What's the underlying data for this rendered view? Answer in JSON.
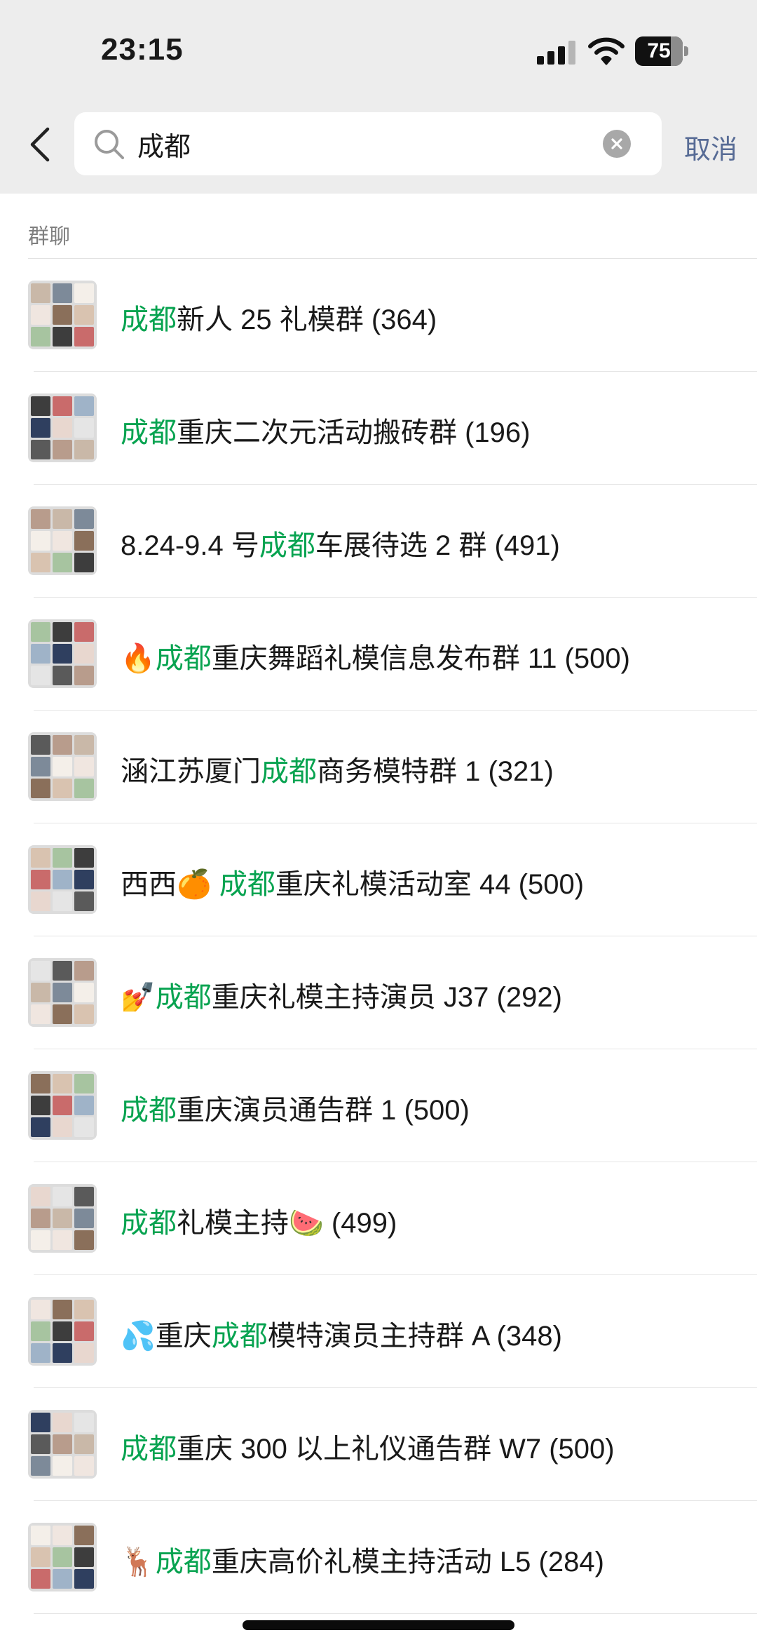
{
  "status_bar": {
    "time": "23:15",
    "battery": "75",
    "battery_level": 0.75
  },
  "search": {
    "query": "成都",
    "cancel_label": "取消"
  },
  "section_title": "群聊",
  "groups": [
    {
      "prefix": "",
      "highlight": "成都",
      "suffix": "新人 25 礼模群 (364)"
    },
    {
      "prefix": "",
      "highlight": "成都",
      "suffix": "重庆二次元活动搬砖群 (196)"
    },
    {
      "prefix": "8.24-9.4 号",
      "highlight": "成都",
      "suffix": "车展待选 2 群 (491)"
    },
    {
      "prefix": "🔥",
      "highlight": "成都",
      "suffix": "重庆舞蹈礼模信息发布群 11 (500)"
    },
    {
      "prefix": "涵江苏厦门",
      "highlight": "成都",
      "suffix": "商务模特群 1 (321)"
    },
    {
      "prefix": "西西🍊 ",
      "highlight": "成都",
      "suffix": "重庆礼模活动室 44 (500)"
    },
    {
      "prefix": "💅",
      "highlight": "成都",
      "suffix": "重庆礼模主持演员 J37 (292)"
    },
    {
      "prefix": "",
      "highlight": "成都",
      "suffix": "重庆演员通告群 1 (500)"
    },
    {
      "prefix": "",
      "highlight": "成都",
      "suffix": "礼模主持🍉 (499)"
    },
    {
      "prefix": "💦重庆",
      "highlight": "成都",
      "suffix": "模特演员主持群 A (348)"
    },
    {
      "prefix": "",
      "highlight": "成都",
      "suffix": "重庆 300 以上礼仪通告群 W7 (500)"
    },
    {
      "prefix": "🦌",
      "highlight": "成都",
      "suffix": "重庆高价礼模主持活动 L5 (284)"
    }
  ]
}
